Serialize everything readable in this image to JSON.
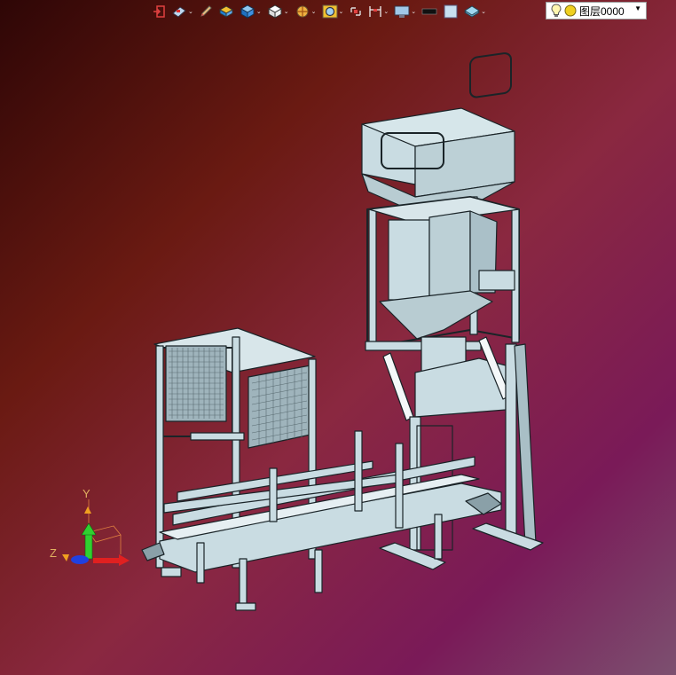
{
  "toolbar": {
    "items": [
      {
        "icon": "exit-sketch-icon",
        "caret": false
      },
      {
        "icon": "render-style-icon",
        "caret": true
      },
      {
        "icon": "pencil-icon",
        "caret": false
      },
      {
        "icon": "layered-box-icon",
        "caret": false
      },
      {
        "icon": "blue-cube-icon",
        "caret": true
      },
      {
        "icon": "white-cube-icon",
        "caret": true
      },
      {
        "icon": "section-view-icon",
        "caret": true
      },
      {
        "icon": "zoom-fit-icon",
        "caret": true
      },
      {
        "icon": "rotate-view-icon",
        "caret": false
      },
      {
        "icon": "dimension-icon",
        "caret": true
      },
      {
        "icon": "monitor-icon",
        "caret": true
      },
      {
        "icon": "black-swatch-icon",
        "caret": false
      },
      {
        "icon": "light-swatch-icon",
        "caret": false
      },
      {
        "icon": "plane-icon",
        "caret": true
      }
    ],
    "caret_glyph": "⌄"
  },
  "layer": {
    "value": "图层0000",
    "dropdown_glyph": "▼"
  },
  "triad": {
    "x_label": "",
    "y_label": "Y",
    "z_label": "Z"
  },
  "colors": {
    "part": "#c9dce2",
    "edge": "#1a2428",
    "accent_red": "#e02020",
    "accent_green": "#20c020",
    "accent_blue": "#2040e0"
  }
}
